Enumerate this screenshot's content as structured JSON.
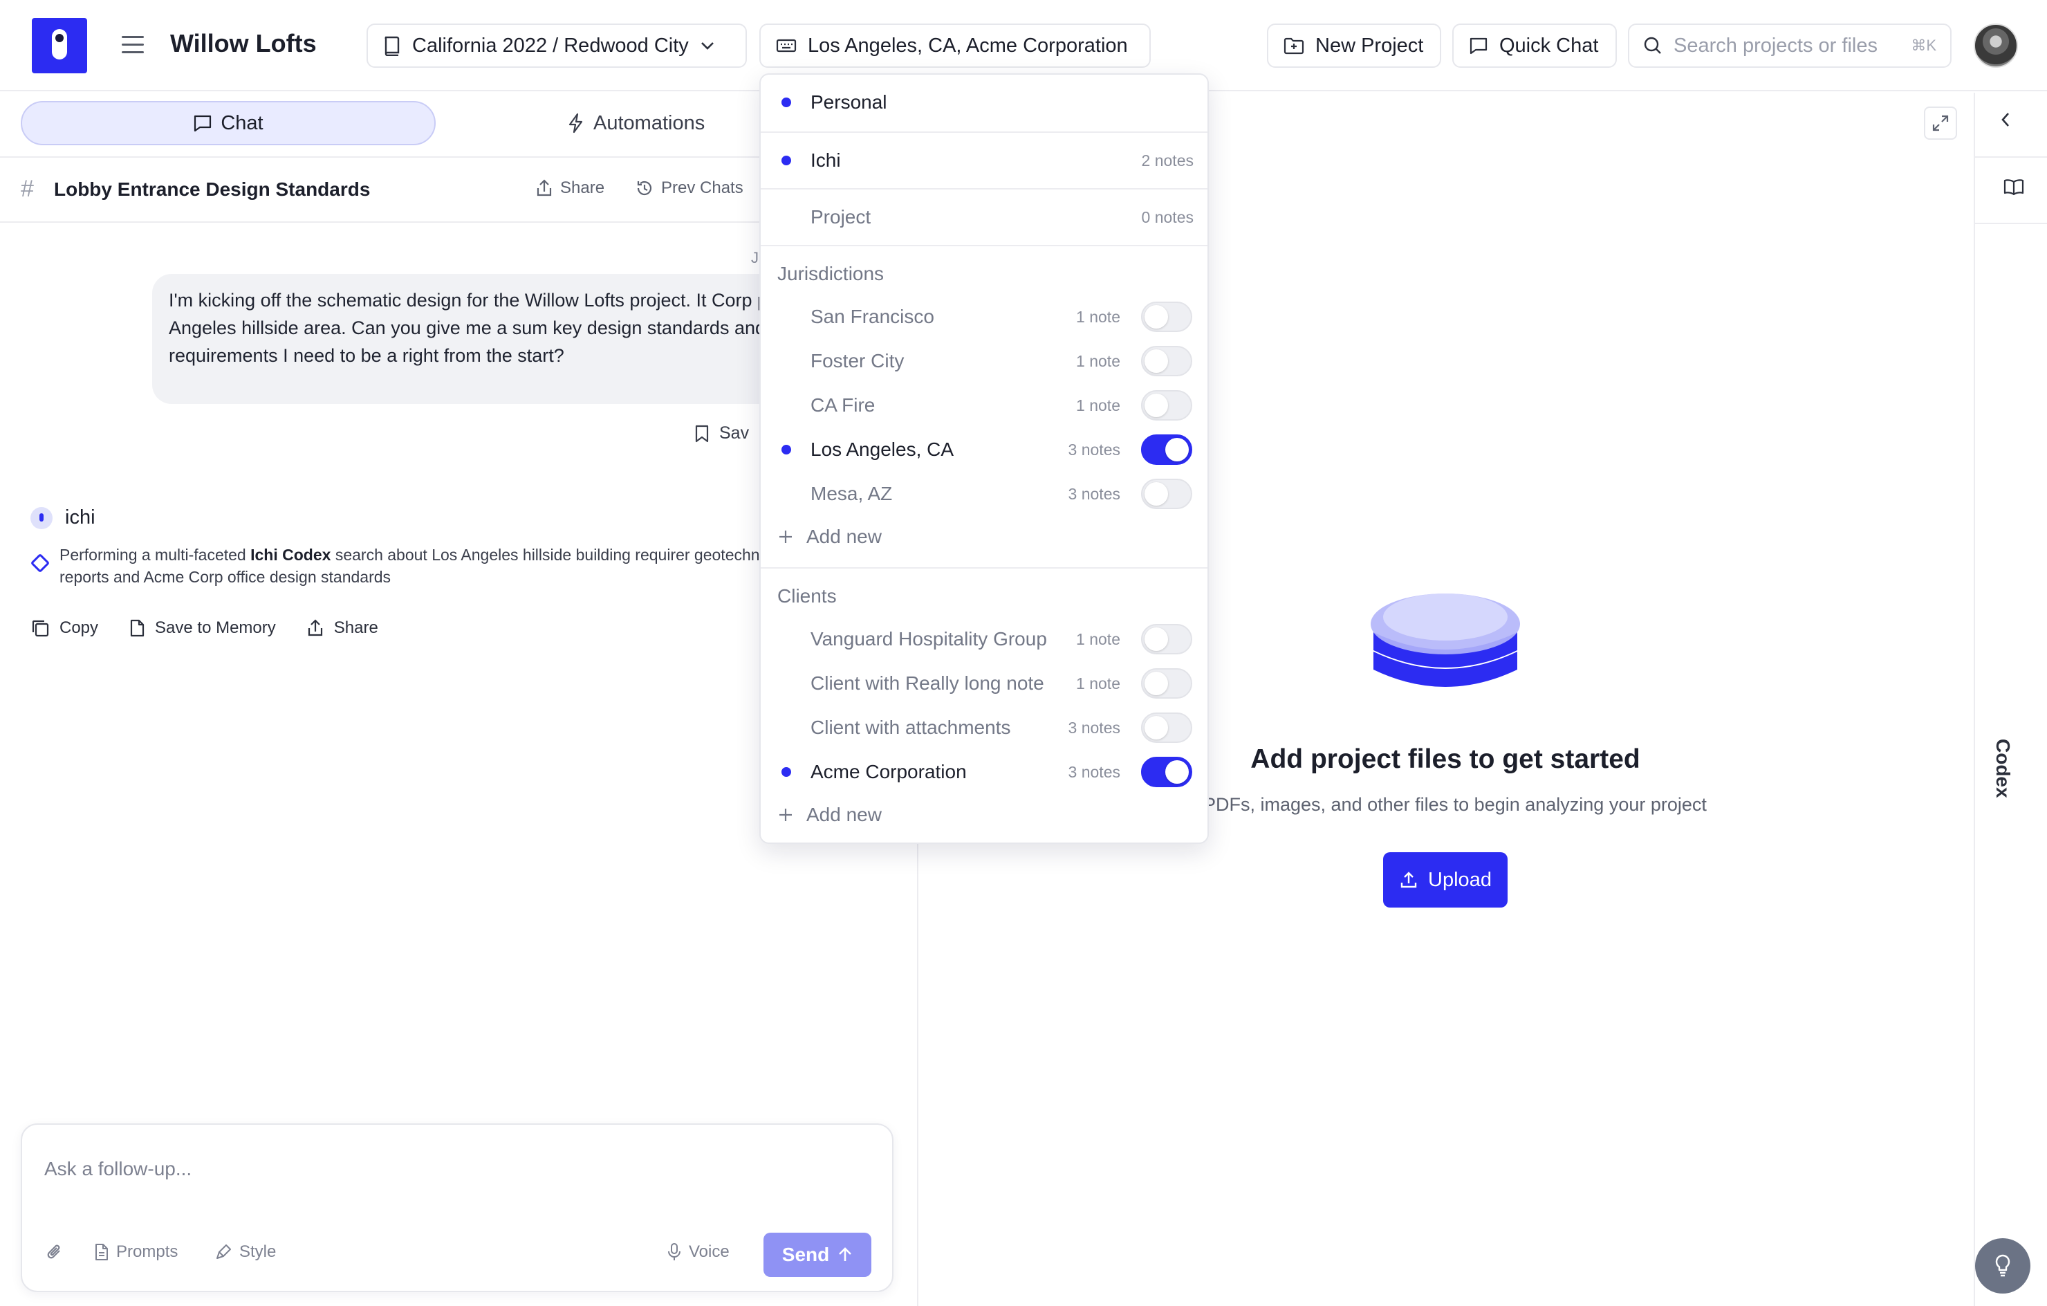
{
  "app": {
    "title": "Willow Lofts"
  },
  "topbar": {
    "project_selector": "California 2022 / Redwood City",
    "context_selector": "Los Angeles, CA, Acme Corporation",
    "new_project_label": "New Project",
    "quick_chat_label": "Quick Chat",
    "search_placeholder": "Search projects or files",
    "search_shortcut": "⌘K"
  },
  "tabs": {
    "chat": "Chat",
    "automations": "Automations"
  },
  "chat": {
    "thread_title": "Lobby Entrance Design Standards",
    "share_label": "Share",
    "prev_chats_label": "Prev Chats",
    "date_stub": "J",
    "user_message": "I'm kicking off the schematic design for the Willow Lofts project. It Corp project in a Los Angeles hillside area. Can you give me a sum key design standards and jurisdictional requirements I need to be a right from the start?",
    "save_stub": "Sav",
    "assistant_name": "ichi",
    "status_prefix": "Performing a multi-faceted ",
    "status_bold": "Ichi Codex",
    "status_suffix": " search about Los Angeles hillside building requirer geotechnical reports and Acme Corp office design standards",
    "actions": {
      "copy": "Copy",
      "save_memory": "Save to Memory",
      "share": "Share"
    }
  },
  "composer": {
    "placeholder": "Ask a follow-up...",
    "prompts": "Prompts",
    "style": "Style",
    "voice": "Voice",
    "send": "Send"
  },
  "empty_state": {
    "title": "Add project files to get started",
    "subtitle": "PDFs, images, and other files to begin analyzing your project",
    "upload": "Upload"
  },
  "rail": {
    "codex_label": "Codex"
  },
  "dropdown": {
    "top_items": [
      {
        "label": "Personal",
        "notes": "",
        "selected": true
      },
      {
        "label": "Ichi",
        "notes": "2 notes",
        "selected": true
      },
      {
        "label": "Project",
        "notes": "0 notes",
        "selected": false
      }
    ],
    "jurisdictions_heading": "Jurisdictions",
    "jurisdictions": [
      {
        "label": "San Francisco",
        "notes": "1 note",
        "on": false
      },
      {
        "label": "Foster City",
        "notes": "1 note",
        "on": false
      },
      {
        "label": "CA Fire",
        "notes": "1 note",
        "on": false
      },
      {
        "label": "Los Angeles, CA",
        "notes": "3 notes",
        "on": true
      },
      {
        "label": "Mesa, AZ",
        "notes": "3 notes",
        "on": false
      }
    ],
    "clients_heading": "Clients",
    "clients": [
      {
        "label": "Vanguard Hospitality Group",
        "notes": "1 note",
        "on": false
      },
      {
        "label": "Client with Really long note",
        "notes": "1 note",
        "on": false
      },
      {
        "label": "Client with attachments",
        "notes": "3 notes",
        "on": false
      },
      {
        "label": "Acme Corporation",
        "notes": "3 notes",
        "on": true
      }
    ],
    "add_new": "Add new"
  },
  "colors": {
    "accent": "#2c2cf2",
    "accent_soft": "#e9ebff",
    "send_disabled": "#8f92f4"
  }
}
